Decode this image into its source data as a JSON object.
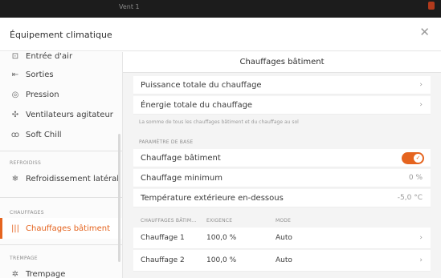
{
  "topbar": {
    "label": "Vent 1"
  },
  "dialog": {
    "title": "Équipement climatique",
    "close_icon": "close-icon"
  },
  "sidebar": {
    "items": [
      {
        "label": "Entrée d'air",
        "icon": "air-inlet-icon",
        "glyph": "⊡",
        "active": false
      },
      {
        "label": "Sorties",
        "icon": "outlet-icon",
        "glyph": "⇤",
        "active": false
      },
      {
        "label": "Pression",
        "icon": "gauge-icon",
        "glyph": "◎",
        "active": false
      },
      {
        "label": "Ventilateurs agitateur",
        "icon": "fan-icon",
        "glyph": "✣",
        "active": false
      },
      {
        "label": "Soft Chill",
        "icon": "soft-chill-icon",
        "glyph": "ꝏ",
        "active": false
      },
      {
        "label": "Refroidissement latéral",
        "icon": "snowflake-icon",
        "glyph": "❄",
        "active": false
      },
      {
        "label": "Chauffages bâtiment",
        "icon": "heater-icon",
        "glyph": "|||",
        "active": true
      },
      {
        "label": "Trempage",
        "icon": "soaking-icon",
        "glyph": "✲",
        "active": false
      }
    ],
    "sections": {
      "cooling": "REFROIDISS",
      "heating": "CHAUFFAGES",
      "soaking": "TREMPAGE"
    }
  },
  "main": {
    "title": "Chauffages bâtiment",
    "rows": {
      "total_power": "Puissance totale du chauffage",
      "total_energy": "Énergie totale du chauffage"
    },
    "note": "La somme de tous les chauffages bâtiment et du chauffage au sol",
    "base_section": "PARAMÈTRE DE BASE",
    "building_heating": {
      "label": "Chauffage bâtiment",
      "enabled": true,
      "check": "✓"
    },
    "min_heating": {
      "label": "Chauffage minimum",
      "value": "0 %"
    },
    "outside_temp": {
      "label": "Température extérieure en-dessous",
      "value": "-5,0 °C"
    },
    "table": {
      "headers": [
        "CHAUFFAGES BÂTIM...",
        "EXIGENCE",
        "MODE"
      ],
      "rows": [
        {
          "name": "Chauffage 1",
          "requirement": "100,0 %",
          "mode": "Auto"
        },
        {
          "name": "Chauffage 2",
          "requirement": "100,0 %",
          "mode": "Auto"
        }
      ]
    },
    "chevron": "›"
  },
  "colors": {
    "accent": "#e5641f",
    "background": "#f4f4f4"
  }
}
